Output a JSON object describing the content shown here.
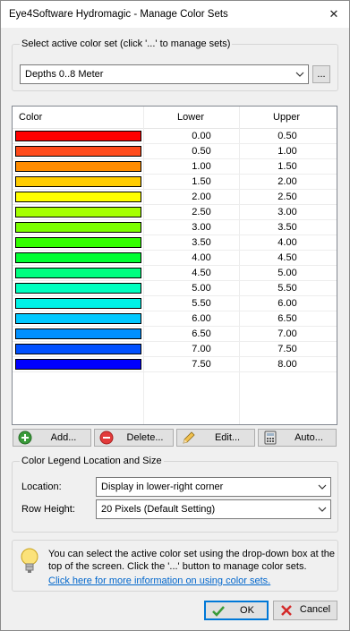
{
  "window": {
    "title": "Eye4Software Hydromagic - Manage Color Sets",
    "close_symbol": "✕"
  },
  "color_set_group": {
    "label": "Select active color set (click '...' to manage sets)",
    "selected": "Depths 0..8 Meter",
    "manage_button": "..."
  },
  "table": {
    "headers": {
      "color": "Color",
      "lower": "Lower",
      "upper": "Upper"
    },
    "rows": [
      {
        "color": "#ff0000",
        "lower": "0.00",
        "upper": "0.50"
      },
      {
        "color": "#ff4a1a",
        "lower": "0.50",
        "upper": "1.00"
      },
      {
        "color": "#ff8c00",
        "lower": "1.00",
        "upper": "1.50"
      },
      {
        "color": "#ffcc00",
        "lower": "1.50",
        "upper": "2.00"
      },
      {
        "color": "#ffff00",
        "lower": "2.00",
        "upper": "2.50"
      },
      {
        "color": "#a6ff00",
        "lower": "2.50",
        "upper": "3.00"
      },
      {
        "color": "#7cff00",
        "lower": "3.00",
        "upper": "3.50"
      },
      {
        "color": "#33ff00",
        "lower": "3.50",
        "upper": "4.00"
      },
      {
        "color": "#00ff33",
        "lower": "4.00",
        "upper": "4.50"
      },
      {
        "color": "#00ff80",
        "lower": "4.50",
        "upper": "5.00"
      },
      {
        "color": "#00ffbf",
        "lower": "5.00",
        "upper": "5.50"
      },
      {
        "color": "#00f2e6",
        "lower": "5.50",
        "upper": "6.00"
      },
      {
        "color": "#00c8ff",
        "lower": "6.00",
        "upper": "6.50"
      },
      {
        "color": "#0090ff",
        "lower": "6.50",
        "upper": "7.00"
      },
      {
        "color": "#0050ff",
        "lower": "7.00",
        "upper": "7.50"
      },
      {
        "color": "#0000ff",
        "lower": "7.50",
        "upper": "8.00"
      }
    ]
  },
  "actions": {
    "add": "Add...",
    "delete": "Delete...",
    "edit": "Edit...",
    "auto": "Auto..."
  },
  "legend_group": {
    "label": "Color Legend Location and Size",
    "location_label": "Location:",
    "location_value": "Display in lower-right corner",
    "row_height_label": "Row Height:",
    "row_height_value": "20 Pixels (Default Setting)"
  },
  "hint": {
    "text": "You can select the active color set using the drop-down box at the top of the screen. Click the '...' button to manage color sets.",
    "link": "Click here for more information on using color sets."
  },
  "dialog_buttons": {
    "ok": "OK",
    "cancel": "Cancel"
  }
}
